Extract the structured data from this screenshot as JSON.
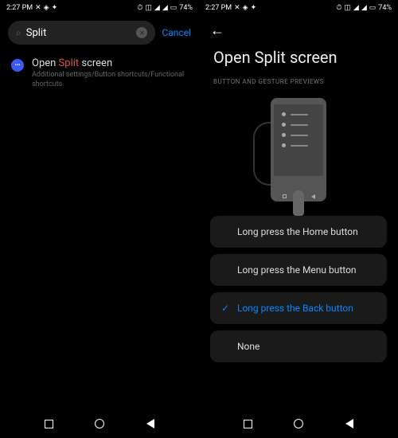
{
  "status": {
    "time": "2:27 PM",
    "battery": "74%",
    "left_icons": [
      "✕",
      "⬛",
      "✦"
    ],
    "right_icons": [
      "⚙",
      "⬛",
      "📶",
      "📶",
      "🔋"
    ]
  },
  "left_screen": {
    "search": {
      "query": "Split",
      "cancel": "Cancel"
    },
    "result": {
      "title_pre": "Open ",
      "title_highlight": "Split",
      "title_post": " screen",
      "path": "Additional settings/Button shortcuts/Functional shortcuts"
    }
  },
  "right_screen": {
    "title": "Open Split screen",
    "section": "BUTTON AND GESTURE PREVIEWS",
    "options": [
      {
        "label": "Long press the Home button",
        "selected": false
      },
      {
        "label": "Long press the Menu button",
        "selected": false
      },
      {
        "label": "Long press the Back button",
        "selected": true
      },
      {
        "label": "None",
        "selected": false
      }
    ]
  }
}
